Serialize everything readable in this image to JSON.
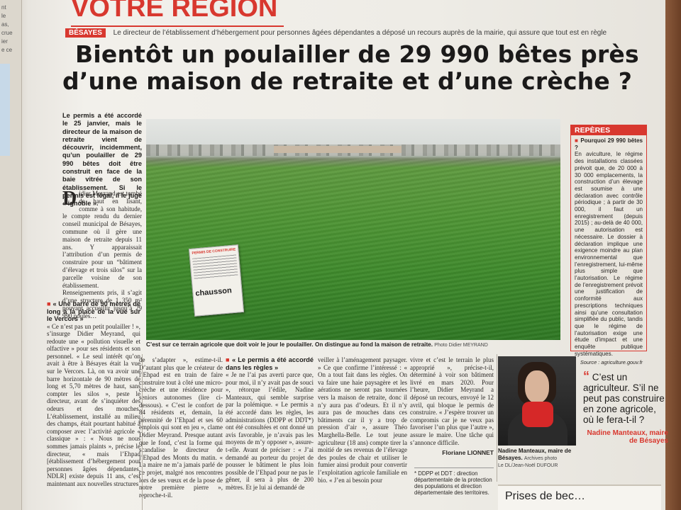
{
  "prev_page": {
    "fragments": [
      "nt",
      "le",
      "as,",
      "crue",
      "ier",
      "e ce"
    ]
  },
  "section": "VOTRE RÉGION",
  "tag": "BÉSAYES",
  "kicker": "Le directeur de l’établissement d’hébergement pour personnes âgées dépendantes a déposé un recours auprès de la mairie, qui assure que tout est en règle",
  "headline": {
    "line1": "Bientôt un poulailler de 29 990 bêtes près",
    "line2": "d’une maison de retraite et d’une crèche ?"
  },
  "lede": "Le permis a été accordé le 25 janvier, mais le directeur de la maison de retraite vient de découvrir, incidemment, qu’un poulailler de 29 990 bêtes doit être construit en face de la baie vitrée de son établissement. Si le permis est légal, il le juge « ignoble ».",
  "intro": {
    "dropcap": "D",
    "text": "idier Meyrand est tombé de haut en lisant, comme à son habitude, le compte rendu du dernier conseil municipal de Bésayes, commune où il gère une maison de retraite depuis 11 ans. Y apparaissait l’attribution d’un permis de construire pour un “bâtiment d’élevage et trois silos” sur la parcelle voisine de son établissement. Renseignements pris, il s’agit d’une structure de 1 350 m² pouvant accueillir jusqu’à 29 990 poules…"
  },
  "col1": {
    "subhead": "« Une barre de 90 mètres de long à la place de la vue sur le Vercors »",
    "text": "« Ce n’est pas un petit poulailler ! », s’insurge Didier Meyrand, qui redoute une « pollution visuelle et olfactive » pour ses résidents et son personnel. « Le seul intérêt qu’on avait à être à Bésayes était la vue sur le Vercors. Là, on va avoir une barre horizontale de 90 mètres de long et 5,70 mètres de haut, sans compter les silos », peste le directeur, avant de s’inquiéter des odeurs et des mouches. L’établissement, installé au milieu des champs, était pourtant habitué à composer avec l’activité agricole « classique » : « Nous ne nous sommes jamais plaints », précise le directeur, « mais l’Ehpad [établissement d’hébergement pour personnes âgées dépendantes, NDLR] existe depuis 11 ans, c’est maintenant aux nouvelles structures"
  },
  "col2": {
    "text": "de s’adapter », estime-t-il. D’autant plus que le créateur de l’Ehpad est en train de faire construire tout à côté une micro-crèche et une résidence pour seniors autonomes (lire ci-dessous). « C’est le confort de 84 résidents et, demain, la pérennité de l’Ehpad et ses 60 emplois qui sont en jeu », clame Didier Meyrand. Presque autant que le fond, c’est la forme qui scandalise le directeur de l’Ehpad des Monts du matin. « La maire ne m’a jamais parlé de ce projet, malgré nos rencontres lors de ses vœux et de la pose de notre première pierre », reproche-t-il."
  },
  "col3": {
    "subhead": "« Le permis a été accordé dans les règles »",
    "text": "« Je ne l’ai pas averti parce que, pour moi, il n’y avait pas de souci », rétorque l’édile, Nadine Manteaux, qui semble surprise par la polémique. « Le permis a été accordé dans les règles, les administrations (DDPP et DDT*) ont été consultées et ont donné un avis favorable, je n’avais pas les moyens de m’y opposer », assure-t-elle. Avant de préciser : « J’ai demandé au porteur du projet de pousser le bâtiment le plus loin possible de l’Ehpad pour ne pas le gêner, il sera à plus de 200 mètres. Et je lui ai demandé de"
  },
  "col4": {
    "text": "veiller à l’aménagement paysager. » Ce que confirme l’intéressé : « On a tout fait dans les règles. On va faire une haie paysagère et les aérations ne seront pas tournées vers la maison de retraite, donc il n’y aura pas d’odeurs. Et il n’y aura pas de mouches dans ces bâtiments car il y a trop de pression d’air », assure Théo Marghella-Belle. Le tout jeune agriculteur (18 ans) compte tirer la moitié de ses revenus de l’élevage des poules de chair et utiliser le fumier ainsi produit pour convertir l’exploitation agricole familiale en bio. « J’en ai besoin pour"
  },
  "col5": {
    "text": "vivre et c’est le terrain le plus approprié », précise-t-il, déterminé à voir son bâtiment livré en mars 2020. Pour l’heure, Didier Meyrand a déposé un recours, envoyé le 12 avril, qui bloque le permis de construire. « J’espère trouver un compromis car je ne veux pas favoriser l’un plus que l’autre », assure le maire. Une tâche qui s’annonce difficile.",
    "signature": "Floriane LIONNET"
  },
  "gloss": "* DDPP et DDT : direction départementale de la protection des populations et direction départementale des territoires.",
  "photo": {
    "sign_head": "PERMIS DE CONSTRUIRE",
    "sign_text": "chausson",
    "caption": "C’est sur ce terrain agricole que doit voir le jour le poulailler. On distingue au fond la maison de retraite.",
    "credit": "Photo Didier MEYRAND"
  },
  "reperes": {
    "title": "REPÈRES",
    "question": "Pourquoi 29 990 bêtes ?",
    "text": "En aviculture, le régime des installations classées prévoit que, de 20 000 à 30 000 emplacements, la construction d’un élevage est soumise à une déclaration avec contrôle périodique ; à partir de 30 000, il faut un enregistrement (depuis 2015) ; au-delà de 40 000, une autorisation est nécessaire. Le dossier à déclaration implique une exigence moindre au plan environnemental que l’enregistrement, lui-même plus simple que l’autorisation. Le régime de l’enregistrement prévoit une justification de conformité aux prescriptions techniques ainsi qu’une consultation simplifiée du public, tandis que le régime de l’autorisation exige une étude d’impact et une enquête publique systématiques.",
    "source": "Source : agriculture.gouv.fr"
  },
  "portrait": {
    "name": "Nadine Manteaux, maire de Bésayes.",
    "note": "Archives photo",
    "credit": "Le DL/Jean-Noël DUFOUR"
  },
  "quote": {
    "text": "C’est un agriculteur. S’il ne peut pas construire en zone agricole, où le fera-t-il ?",
    "author": "Nadine Manteaux, maire de Bésayes"
  },
  "bottom_box": "Prises de bec…",
  "colors": {
    "accent_red": "#d8382f",
    "paper": "#f0ede7",
    "ink": "#1f1d1b"
  }
}
